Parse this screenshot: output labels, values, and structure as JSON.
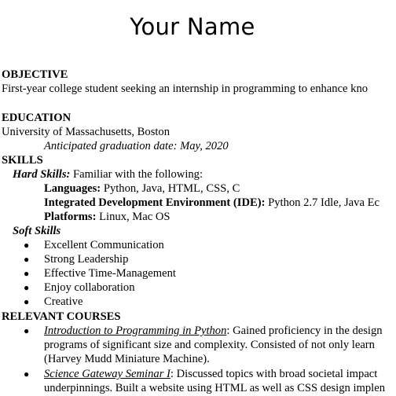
{
  "title": "Your Name",
  "objective": {
    "heading": "OBJECTIVE",
    "text": "First-year college student seeking an internship in programming to enhance kno"
  },
  "education": {
    "heading": "EDUCATION",
    "school": "University of Massachusetts, Boston",
    "graduation": "Anticipated graduation date: May, 2020"
  },
  "skills": {
    "heading": "SKILLS",
    "hard": {
      "label": "Hard Skills:",
      "intro": "Familiar with the following:",
      "items": [
        {
          "label": "Languages:",
          "value": "Python, Java, HTML, CSS, C"
        },
        {
          "label": "Integrated Development Environment (IDE):",
          "value": "Python 2.7 Idle, Java Ec"
        },
        {
          "label": "Platforms:",
          "value": "Linux, Mac OS"
        }
      ]
    },
    "soft": {
      "label": "Soft Skills",
      "items": [
        "Excellent Communication",
        "Strong Leadership",
        "Effective Time-Management",
        "Enjoy collaboration",
        "Creative"
      ]
    }
  },
  "courses": {
    "heading": "RELEVANT COURSES",
    "items": [
      {
        "name": "Introduction to Programming in Python",
        "lines": [
          ": Gained proficiency in the design",
          "programs of significant size and complexity. Consisted of not only learn",
          "(Harvey Mudd Miniature Machine)."
        ]
      },
      {
        "name": "Science Gateway Seminar I",
        "lines": [
          ": Discussed topics with broad societal impact",
          "underpinnings. Built a website using HTML as well as CSS design implen"
        ]
      }
    ]
  },
  "bullet_glyph": "●"
}
